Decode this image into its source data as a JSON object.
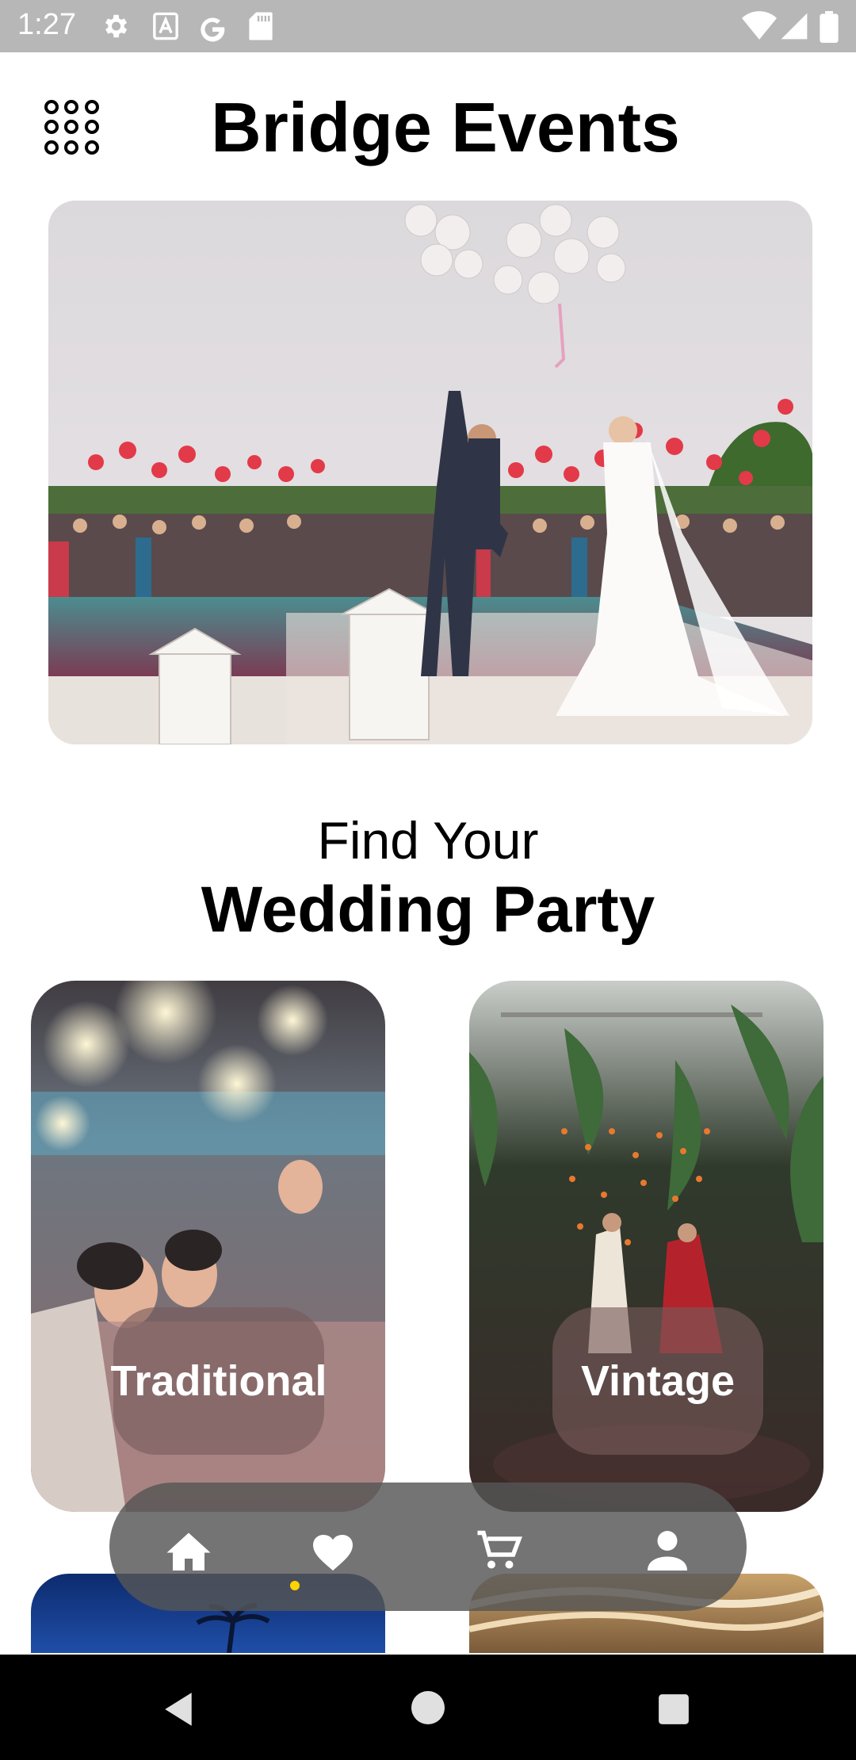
{
  "status_bar": {
    "time": "1:27",
    "icons_left": [
      "settings-icon",
      "font-icon",
      "google-icon",
      "sd-card-icon"
    ],
    "icons_right": [
      "wifi-icon",
      "signal-icon",
      "battery-icon"
    ]
  },
  "header": {
    "title": "Bridge Events",
    "menu_icon": "grid-menu-icon"
  },
  "hero": {
    "image": "wedding couple releasing balloons by a pool"
  },
  "section": {
    "line1": "Find Your",
    "line2": "Wedding Party"
  },
  "categories": [
    {
      "label": "Traditional",
      "image": "sparklers celebration"
    },
    {
      "label": "Vintage",
      "image": "couple dancing under palm leaves"
    }
  ],
  "bottom_nav": {
    "items": [
      "home-icon",
      "heart-icon",
      "cart-icon",
      "profile-icon"
    ],
    "active": "home-icon",
    "indicator_color": "#ffd400"
  },
  "system_nav": [
    "back-icon",
    "home-circle-icon",
    "recents-icon"
  ]
}
